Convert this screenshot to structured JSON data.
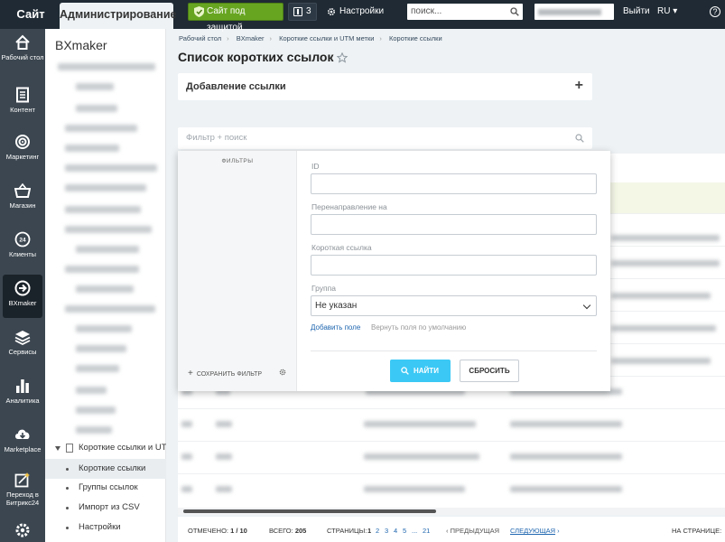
{
  "topbar": {
    "tab_site": "Сайт",
    "tab_admin": "Администрирование",
    "protect_label": "Сайт под защитой",
    "notifications_count": "3",
    "settings_label": "Настройки",
    "search_placeholder": "поиск...",
    "exit_label": "Выйти",
    "lang_label": "RU",
    "help_label": "?"
  },
  "rail": {
    "items": [
      {
        "label": "Рабочий стол",
        "icon": "home-icon"
      },
      {
        "label": "Контент",
        "icon": "document-icon"
      },
      {
        "label": "Маркетинг",
        "icon": "target-icon"
      },
      {
        "label": "Магазин",
        "icon": "basket-icon"
      },
      {
        "label": "Клиенты",
        "icon": "crm-icon"
      },
      {
        "label": "BXmaker",
        "icon": "arrow-circle-icon"
      },
      {
        "label": "Сервисы",
        "icon": "layers-icon"
      },
      {
        "label": "Аналитика",
        "icon": "bar-chart-icon"
      },
      {
        "label": "Marketplace",
        "icon": "cloud-download-icon"
      },
      {
        "label": "Переход в Битрикс24",
        "icon": "bitrix24-icon"
      },
      {
        "label": "",
        "icon": "gear-icon"
      }
    ]
  },
  "tree": {
    "title": "BXmaker",
    "parent": "Короткие ссылки и UTM м",
    "items": [
      {
        "label": "Короткие ссылки"
      },
      {
        "label": "Группы ссылок"
      },
      {
        "label": "Импорт из CSV"
      },
      {
        "label": "Настройки"
      }
    ]
  },
  "breadcrumbs": [
    "Рабочий стол",
    "BXmaker",
    "Короткие ссылки и UTM метки",
    "Короткие ссылки"
  ],
  "page_title": "Список коротких ссылок",
  "add_panel_title": "Добавление ссылки",
  "filter": {
    "search_placeholder": "Фильтр + поиск",
    "filters_heading": "ФИЛЬТРЫ",
    "save_filter": "СОХРАНИТЬ ФИЛЬТР",
    "fields": [
      {
        "label": "ID",
        "value": ""
      },
      {
        "label": "Перенаправление на",
        "value": ""
      },
      {
        "label": "Короткая ссылка",
        "value": ""
      }
    ],
    "group_label": "Группа",
    "group_value": "Не указан",
    "add_field": "Добавить поле",
    "restore_fields": "Вернуть поля по умолчанию",
    "find_button": "НАЙТИ",
    "reset_button": "СБРОСИТЬ"
  },
  "pager": {
    "selected_label": "ОТМЕЧЕНО:",
    "selected_value": "1 / 10",
    "total_label": "ВСЕГО:",
    "total_value": "205",
    "pages_label": "СТРАНИЦЫ:",
    "pages": [
      "1",
      "2",
      "3",
      "4",
      "5",
      "...",
      "21"
    ],
    "prev": "ПРЕДЫДУЩАЯ",
    "next": "СЛЕДУЮЩАЯ",
    "per_page_label": "НА СТРАНИЦЕ:"
  },
  "colors": {
    "topbar": "#1f2a34",
    "rail": "#3b4650",
    "protect_green": "#67a521",
    "find_blue": "#3bc8f5",
    "link_blue": "#2067b0"
  }
}
